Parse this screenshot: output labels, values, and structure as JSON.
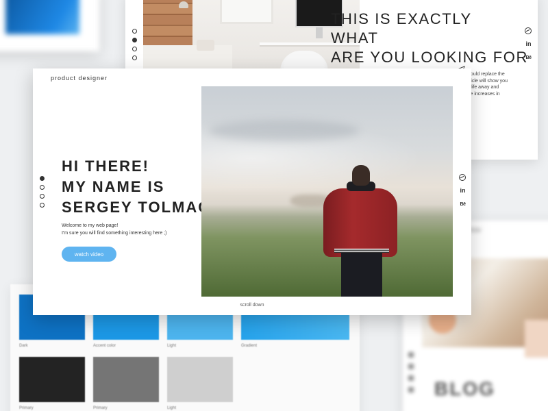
{
  "brand": {
    "tagline": "product designer"
  },
  "hero": {
    "title_lines": [
      "HI THERE!",
      "MY NAME IS",
      "SERGEY TOLMACHOV"
    ],
    "subtitle_lines": [
      "Welcome to my web page!",
      "I'm sure you will find something interesting here ;)"
    ],
    "cta_label": "watch video",
    "cta_color": "#5fb4f0",
    "scroll_hint": "scroll down",
    "nav_dots": {
      "count": 4,
      "active_index": 0
    },
    "social_icons": [
      "dribbble-icon",
      "linkedin-icon",
      "behance-icon"
    ]
  },
  "background_card_top": {
    "headline_lines": [
      "THIS IS EXACTLY",
      "WHAT",
      "ARE YOU LOOKING FOR"
    ],
    "excerpt_lines": [
      "hould replace the",
      "rticle will show you",
      "r life away and",
      "ve increases in"
    ],
    "nav_dots": {
      "count": 4,
      "active_index": 1
    },
    "social_icons": [
      "dribbble-icon",
      "linkedin-icon",
      "behance-icon"
    ]
  },
  "palette": {
    "swatches": [
      {
        "label": "Dark",
        "color": "#0e72c4"
      },
      {
        "label": "Accent color",
        "color": "#1c98e6"
      },
      {
        "label": "Light",
        "color": "#4db5ef"
      },
      {
        "label": "Gradient",
        "color": "#26a3ec"
      },
      {
        "label": "Primary",
        "color": "#232323"
      },
      {
        "label": "Primary",
        "color": "#757575"
      },
      {
        "label": "Light",
        "color": "#cfcfcf"
      }
    ]
  },
  "blog_card": {
    "heading": "BLOG",
    "title": "sergey tolmachov"
  }
}
